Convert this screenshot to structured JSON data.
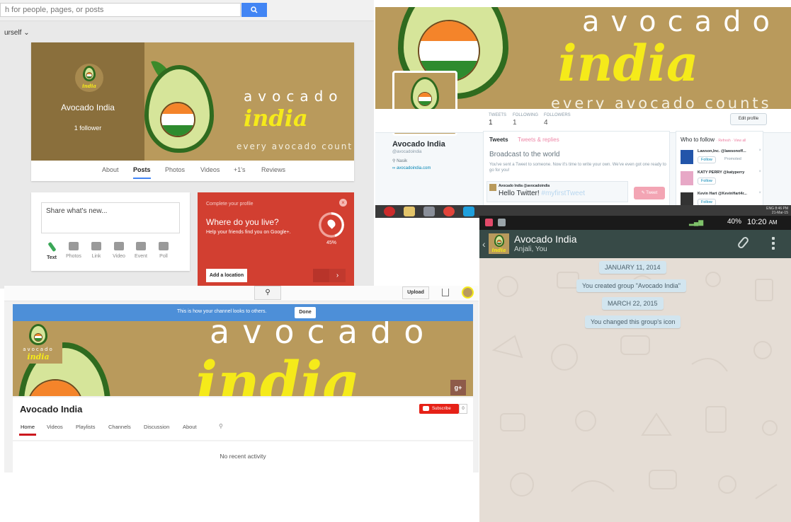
{
  "colors": {
    "banner_tan": "#b99a5c",
    "avocado_green": "#2f6b1f",
    "india_yellow": "#f5ea1a",
    "google_blue": "#4285f4",
    "google_red": "#d23f31",
    "youtube_red": "#e62117",
    "whatsapp_header": "#374a47",
    "whatsapp_bubble": "#d2e5ef"
  },
  "brand": {
    "word1": "avocado",
    "word2": "india",
    "tagline": "every avocado counts",
    "tagline_cropped": "every avocado count"
  },
  "gplus": {
    "search_placeholder": "h for people, pages, or posts",
    "search_button_icon": "search-icon",
    "view_as": "urself",
    "page_name": "Avocado India",
    "followers": "1 follower",
    "tabs": [
      "About",
      "Posts",
      "Photos",
      "Videos",
      "+1's",
      "Reviews"
    ],
    "active_tab": "Posts",
    "share_placeholder": "Share what's new...",
    "share_tools": [
      "Text",
      "Photos",
      "Link",
      "Video",
      "Event",
      "Poll"
    ],
    "complete_profile": {
      "header": "Complete your profile",
      "question": "Where do you live?",
      "subtitle": "Help your friends find you on Google+.",
      "progress_label": "45%",
      "progress_fraction": 0.45,
      "button": "Add a location",
      "next_icon": "chevron-right-icon"
    }
  },
  "twitter": {
    "stats": [
      {
        "label": "TWEETS",
        "value": "1"
      },
      {
        "label": "FOLLOWING",
        "value": "1"
      },
      {
        "label": "FOLLOWERS",
        "value": "4"
      }
    ],
    "edit_profile": "Edit profile",
    "profile_name": "Avocado India",
    "handle": "@avocadoindia",
    "location": "Nasik",
    "website": "avocadoindia.com",
    "tabs": [
      "Tweets",
      "Tweets & replies"
    ],
    "broadcast_title": "Broadcast to the world",
    "broadcast_text": "You've sent a Tweet to someone. Now it's time to write your own. We've even got one ready to go for you!",
    "draft_author": "Avocado India @avocadoindia",
    "draft_text": "Hello Twitter!",
    "draft_hashtag": "#myfirstTweet",
    "tweet_button": "Tweet",
    "who_to_follow": "Who to follow",
    "who_links": "· Refresh · View all",
    "suggestions": [
      {
        "name": "Lawson,Inc. @lawsonoff...",
        "follow": "Follow",
        "extra": "Promoted"
      },
      {
        "name": "KATY PERRY @katyperry",
        "follow": "Follow",
        "extra": ""
      },
      {
        "name": "Kevin Hart @KevinHart4r...",
        "follow": "Follow",
        "extra": ""
      }
    ],
    "clock_time": "8:46 PM",
    "clock_date": "21-Mar-15",
    "tray_lang": "ENG"
  },
  "youtube": {
    "upload": "Upload",
    "banner_notice": "This is how your channel looks to others.",
    "done": "Done",
    "gplus_badge": "g+",
    "channel_name": "Avocado India",
    "subscribe": "Subscribe",
    "subscriber_count": "0",
    "tabs": [
      "Home",
      "Videos",
      "Playlists",
      "Channels",
      "Discussion",
      "About"
    ],
    "active_tab": "Home",
    "empty_state": "No recent activity"
  },
  "whatsapp": {
    "battery": "40%",
    "time": "10:20",
    "time_suffix": "AM",
    "group_name": "Avocado India",
    "members": "Anjali, You",
    "messages": [
      "JANUARY 11, 2014",
      "You created group \"Avocado India\"",
      "MARCH 22, 2015",
      "You changed this group's icon"
    ]
  }
}
